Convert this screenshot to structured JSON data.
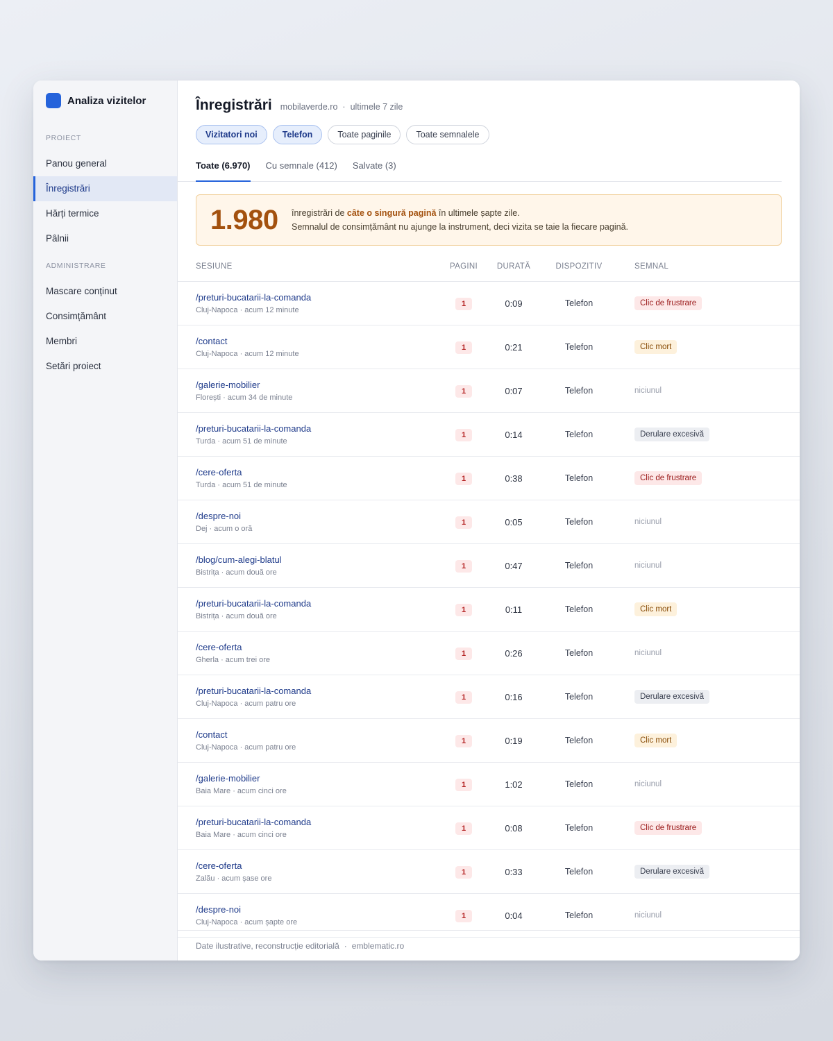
{
  "app": {
    "name": "Analiza vizitelor"
  },
  "sidebar": {
    "sections": [
      {
        "label": "PROIECT",
        "items": [
          {
            "label": "Panou general",
            "active": false
          },
          {
            "label": "Înregistrări",
            "active": true
          },
          {
            "label": "Hărți termice",
            "active": false
          },
          {
            "label": "Pâlnii",
            "active": false
          }
        ]
      },
      {
        "label": "ADMINISTRARE",
        "items": [
          {
            "label": "Mascare conținut",
            "active": false
          },
          {
            "label": "Consimțământ",
            "active": false
          },
          {
            "label": "Membri",
            "active": false
          },
          {
            "label": "Setări proiect",
            "active": false
          }
        ]
      }
    ]
  },
  "header": {
    "title": "Înregistrări",
    "site": "mobilaverde.ro",
    "separator": "·",
    "period": "ultimele 7 zile",
    "filters": [
      {
        "label": "Vizitatori noi",
        "active": true
      },
      {
        "label": "Telefon",
        "active": true
      },
      {
        "label": "Toate paginile",
        "active": false
      },
      {
        "label": "Toate semnalele",
        "active": false
      }
    ],
    "tabs": [
      {
        "label": "Toate (6.970)",
        "active": true
      },
      {
        "label": "Cu semnale (412)",
        "active": false
      },
      {
        "label": "Salvate (3)",
        "active": false
      }
    ]
  },
  "banner": {
    "value": "1.980",
    "line1_pre": "înregistrări de ",
    "line1_bold": "câte o singură pagină",
    "line1_post": " în ultimele șapte zile.",
    "line2": "Semnalul de consimțământ nu ajunge la instrument, deci vizita se taie la fiecare pagină."
  },
  "table": {
    "columns": {
      "session": "SESIUNE",
      "pages": "PAGINI",
      "duration": "DURATĂ",
      "device": "DISPOZITIV",
      "signal": "SEMNAL"
    },
    "rows": [
      {
        "path": "/preturi-bucatarii-la-comanda",
        "meta": "Cluj-Napoca · acum 12 minute",
        "pages": "1",
        "duration": "0:09",
        "device": "Telefon",
        "signal": "Clic de frustrare",
        "signal_type": "frustrare"
      },
      {
        "path": "/contact",
        "meta": "Cluj-Napoca · acum 12 minute",
        "pages": "1",
        "duration": "0:21",
        "device": "Telefon",
        "signal": "Clic mort",
        "signal_type": "mort"
      },
      {
        "path": "/galerie-mobilier",
        "meta": "Florești · acum 34 de minute",
        "pages": "1",
        "duration": "0:07",
        "device": "Telefon",
        "signal": "niciunul",
        "signal_type": "none"
      },
      {
        "path": "/preturi-bucatarii-la-comanda",
        "meta": "Turda · acum 51 de minute",
        "pages": "1",
        "duration": "0:14",
        "device": "Telefon",
        "signal": "Derulare excesivă",
        "signal_type": "derulare"
      },
      {
        "path": "/cere-oferta",
        "meta": "Turda · acum 51 de minute",
        "pages": "1",
        "duration": "0:38",
        "device": "Telefon",
        "signal": "Clic de frustrare",
        "signal_type": "frustrare"
      },
      {
        "path": "/despre-noi",
        "meta": "Dej · acum o oră",
        "pages": "1",
        "duration": "0:05",
        "device": "Telefon",
        "signal": "niciunul",
        "signal_type": "none"
      },
      {
        "path": "/blog/cum-alegi-blatul",
        "meta": "Bistrița · acum două ore",
        "pages": "1",
        "duration": "0:47",
        "device": "Telefon",
        "signal": "niciunul",
        "signal_type": "none"
      },
      {
        "path": "/preturi-bucatarii-la-comanda",
        "meta": "Bistrița · acum două ore",
        "pages": "1",
        "duration": "0:11",
        "device": "Telefon",
        "signal": "Clic mort",
        "signal_type": "mort"
      },
      {
        "path": "/cere-oferta",
        "meta": "Gherla · acum trei ore",
        "pages": "1",
        "duration": "0:26",
        "device": "Telefon",
        "signal": "niciunul",
        "signal_type": "none"
      },
      {
        "path": "/preturi-bucatarii-la-comanda",
        "meta": "Cluj-Napoca · acum patru ore",
        "pages": "1",
        "duration": "0:16",
        "device": "Telefon",
        "signal": "Derulare excesivă",
        "signal_type": "derulare"
      },
      {
        "path": "/contact",
        "meta": "Cluj-Napoca · acum patru ore",
        "pages": "1",
        "duration": "0:19",
        "device": "Telefon",
        "signal": "Clic mort",
        "signal_type": "mort"
      },
      {
        "path": "/galerie-mobilier",
        "meta": "Baia Mare · acum cinci ore",
        "pages": "1",
        "duration": "1:02",
        "device": "Telefon",
        "signal": "niciunul",
        "signal_type": "none"
      },
      {
        "path": "/preturi-bucatarii-la-comanda",
        "meta": "Baia Mare · acum cinci ore",
        "pages": "1",
        "duration": "0:08",
        "device": "Telefon",
        "signal": "Clic de frustrare",
        "signal_type": "frustrare"
      },
      {
        "path": "/cere-oferta",
        "meta": "Zalău · acum șase ore",
        "pages": "1",
        "duration": "0:33",
        "device": "Telefon",
        "signal": "Derulare excesivă",
        "signal_type": "derulare"
      },
      {
        "path": "/despre-noi",
        "meta": "Cluj-Napoca · acum șapte ore",
        "pages": "1",
        "duration": "0:04",
        "device": "Telefon",
        "signal": "niciunul",
        "signal_type": "none"
      }
    ]
  },
  "footer": {
    "note": "Date ilustrative, reconstrucție editorială",
    "separator": "·",
    "site": "emblematic.ro"
  },
  "colors": {
    "accent": "#2563db",
    "banner_value": "#a3510e",
    "link": "#1e3a8a"
  }
}
